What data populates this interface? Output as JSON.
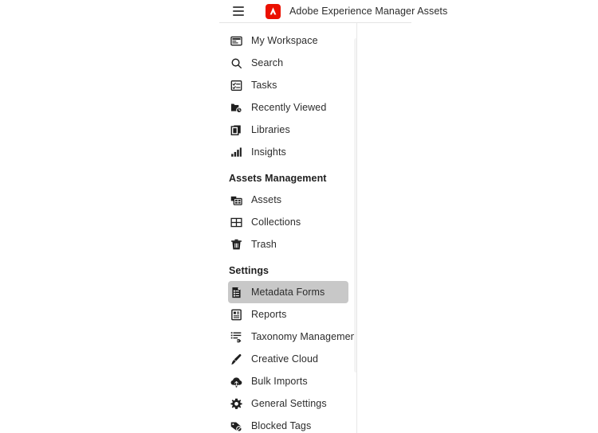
{
  "header": {
    "menu_icon": "hamburger-icon",
    "logo_icon": "adobe-logo-icon",
    "title": "Adobe Experience Manager Assets"
  },
  "sidebar": {
    "groups": [
      {
        "title": null,
        "items": [
          {
            "label": "My Workspace",
            "icon": "workspace-icon",
            "selected": false
          },
          {
            "label": "Search",
            "icon": "search-icon",
            "selected": false
          },
          {
            "label": "Tasks",
            "icon": "tasks-icon",
            "selected": false
          },
          {
            "label": "Recently Viewed",
            "icon": "recently-viewed-icon",
            "selected": false
          },
          {
            "label": "Libraries",
            "icon": "libraries-icon",
            "selected": false
          },
          {
            "label": "Insights",
            "icon": "insights-icon",
            "selected": false
          }
        ]
      },
      {
        "title": "Assets Management",
        "items": [
          {
            "label": "Assets",
            "icon": "assets-icon",
            "selected": false
          },
          {
            "label": "Collections",
            "icon": "collections-icon",
            "selected": false
          },
          {
            "label": "Trash",
            "icon": "trash-icon",
            "selected": false
          }
        ]
      },
      {
        "title": "Settings",
        "items": [
          {
            "label": "Metadata Forms",
            "icon": "metadata-forms-icon",
            "selected": true
          },
          {
            "label": "Reports",
            "icon": "reports-icon",
            "selected": false
          },
          {
            "label": "Taxonomy Management",
            "icon": "taxonomy-icon",
            "selected": false
          },
          {
            "label": "Creative Cloud",
            "icon": "brush-icon",
            "selected": false
          },
          {
            "label": "Bulk Imports",
            "icon": "cloud-upload-icon",
            "selected": false
          },
          {
            "label": "General Settings",
            "icon": "gear-icon",
            "selected": false
          },
          {
            "label": "Blocked Tags",
            "icon": "blocked-tag-icon",
            "selected": false
          }
        ]
      }
    ]
  },
  "colors": {
    "brand_red": "#eb1000",
    "selected_row": "#c8c8c8",
    "text": "#2c2c2c",
    "border": "#e4e4e4"
  }
}
